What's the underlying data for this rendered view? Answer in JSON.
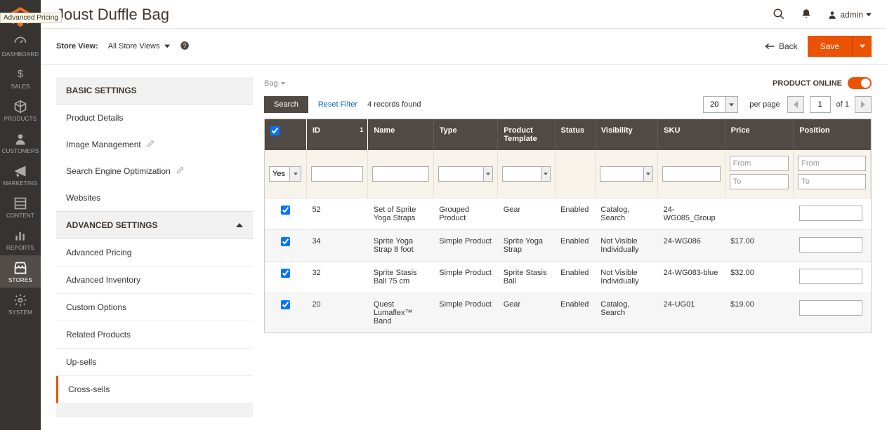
{
  "tooltip": "Advanced Pricing",
  "adminNav": [
    {
      "key": "dashboard",
      "label": "DASHBOARD"
    },
    {
      "key": "sales",
      "label": "SALES"
    },
    {
      "key": "products",
      "label": "PRODUCTS"
    },
    {
      "key": "customers",
      "label": "CUSTOMERS"
    },
    {
      "key": "marketing",
      "label": "MARKETING"
    },
    {
      "key": "content",
      "label": "CONTENT"
    },
    {
      "key": "reports",
      "label": "REPORTS"
    },
    {
      "key": "stores",
      "label": "STORES"
    },
    {
      "key": "system",
      "label": "SYSTEM"
    }
  ],
  "page": {
    "title": "Joust Duffle Bag",
    "admin_user": "admin"
  },
  "scope": {
    "label": "Store View:",
    "value": "All Store Views"
  },
  "actions": {
    "back": "Back",
    "save": "Save"
  },
  "settings": {
    "basic_title": "BASIC SETTINGS",
    "advanced_title": "ADVANCED SETTINGS",
    "basic": [
      {
        "label": "Product Details",
        "edit": false
      },
      {
        "label": "Image Management",
        "edit": true
      },
      {
        "label": "Search Engine Optimization",
        "edit": true
      },
      {
        "label": "Websites",
        "edit": false
      }
    ],
    "advanced": [
      {
        "label": "Advanced Pricing"
      },
      {
        "label": "Advanced Inventory"
      },
      {
        "label": "Custom Options"
      },
      {
        "label": "Related Products"
      },
      {
        "label": "Up-sells"
      },
      {
        "label": "Cross-sells"
      }
    ]
  },
  "topStrip": {
    "breadcrumb": "Bag",
    "product_online_label": "PRODUCT ONLINE"
  },
  "toolbar": {
    "search": "Search",
    "reset": "Reset Filter",
    "records": "4 records found",
    "per_page_value": "20",
    "per_page_label": "per page",
    "page_value": "1",
    "of_label": "of 1"
  },
  "grid": {
    "headers": {
      "id": "ID",
      "name": "Name",
      "type": "Type",
      "tpl": "Product Template",
      "status": "Status",
      "vis": "Visibility",
      "sku": "SKU",
      "price": "Price",
      "pos": "Position"
    },
    "filter": {
      "chk_value": "Yes",
      "from": "From",
      "to": "To"
    },
    "rows": [
      {
        "checked": true,
        "id": "52",
        "name": "Set of Sprite Yoga Straps",
        "type": "Grouped Product",
        "tpl": "Gear",
        "status": "Enabled",
        "vis": "Catalog, Search",
        "sku": "24-WG085_Group",
        "price": ""
      },
      {
        "checked": true,
        "id": "34",
        "name": "Sprite Yoga Strap 8 foot",
        "type": "Simple Product",
        "tpl": "Sprite Yoga Strap",
        "status": "Enabled",
        "vis": "Not Visible Individually",
        "sku": "24-WG086",
        "price": "$17.00"
      },
      {
        "checked": true,
        "id": "32",
        "name": "Sprite Stasis Ball 75 cm",
        "type": "Simple Product",
        "tpl": "Sprite Stasis Ball",
        "status": "Enabled",
        "vis": "Not Visible Individually",
        "sku": "24-WG083-blue",
        "price": "$32.00"
      },
      {
        "checked": true,
        "id": "20",
        "name": "Quest Lumaflex™ Band",
        "type": "Simple Product",
        "tpl": "Gear",
        "status": "Enabled",
        "vis": "Catalog, Search",
        "sku": "24-UG01",
        "price": "$19.00"
      }
    ]
  }
}
